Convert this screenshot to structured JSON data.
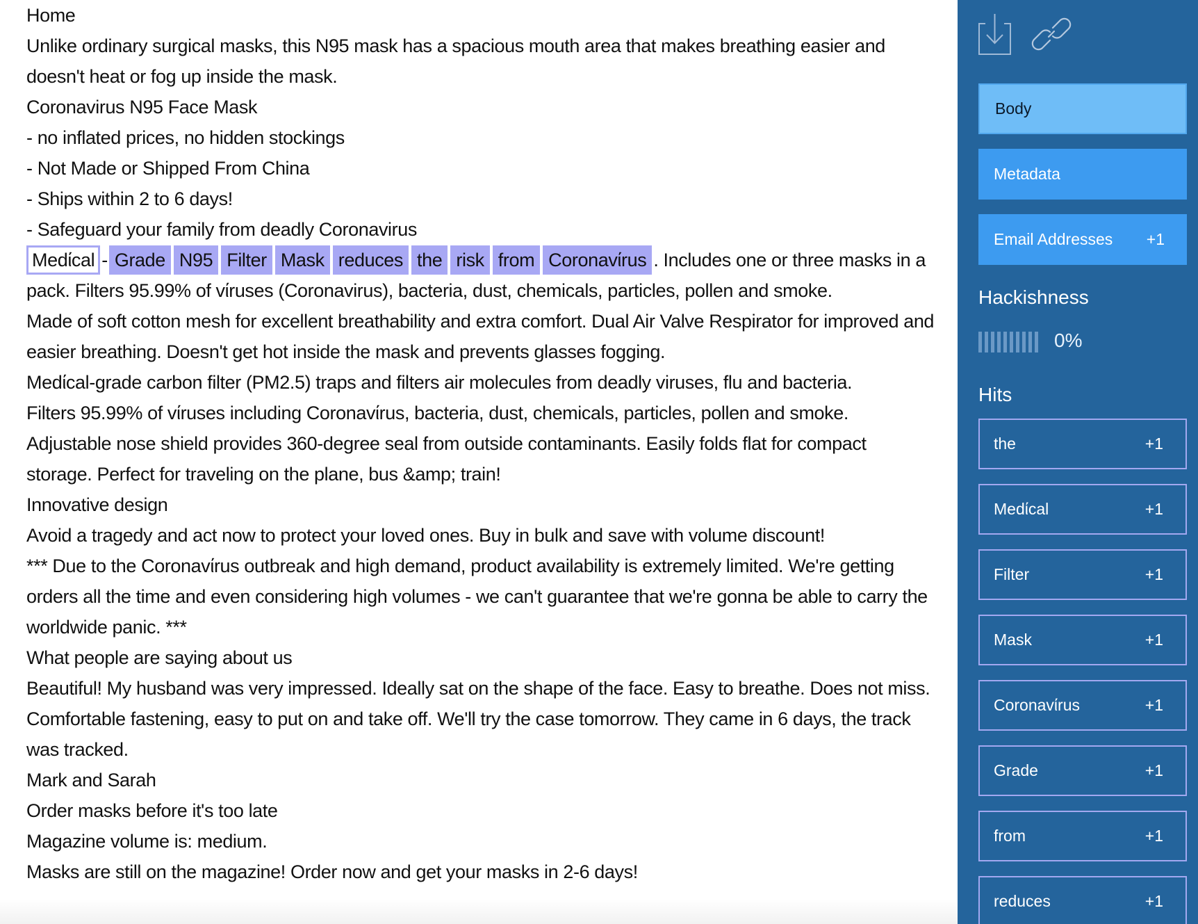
{
  "document": {
    "lines_before": [
      "Home",
      "Unlike ordinary surgical masks, this N95 mask has a spacious mouth area that makes breathing easier and doesn't heat or fog up inside the mask.",
      "Coronavirus N95 Face Mask",
      "- no inflated prices, no hidden stockings",
      "- Not Made or Shipped From China",
      "- Ships within 2 to 6 days!",
      "- Safeguard your family from deadly Coronavirus"
    ],
    "highlighted_sentence": {
      "tokens": [
        {
          "text": "Medίcal",
          "focused": true
        },
        {
          "sep": "-"
        },
        {
          "text": "Grade"
        },
        {
          "text": "N95"
        },
        {
          "text": "Filter"
        },
        {
          "text": "Mask"
        },
        {
          "text": "reduces"
        },
        {
          "text": "the"
        },
        {
          "text": "risk"
        },
        {
          "text": "from"
        },
        {
          "text": "Coronavίrus"
        }
      ],
      "tail": ". Includes one or three masks in a pack. Filters 95.99% of vίruses (Coronavirus), bacteria, dust, chemicals, particles, pollen and smoke."
    },
    "lines_after": [
      "Made of soft cotton mesh for excellent breathability and extra comfort. Dual Air Valve Respirator for improved and easier breathing. Doesn't get hot inside the mask and prevents glasses fogging.",
      "Medίcal-grade carbon filter (PM2.5) traps and filters air molecules from deadly viruses, flu and bacteria.",
      "Filters 95.99% of vίruses including Coronavίrus, bacteria, dust, chemicals, particles, pollen and smoke.",
      "Adjustable nose shield provides 360-degree seal from outside contaminants. Easily folds flat for compact storage. Perfect for traveling on the plane, bus &amp; train!",
      "Innovative design",
      "Avoid a tragedy and act now to protect your loved ones. Buy in bulk and save with volume discount!",
      "*** Due to the Coronavίrus outbreak and high demand, product availability is extremely limited. We're getting orders all the time and even considering high volumes - we can't guarantee that we're gonna be able to carry the worldwide panic. ***",
      "What people are saying about us",
      "Beautiful! My husband was very impressed. Ideally sat on the shape of the face. Easy to breathe. Does not miss. Comfortable fastening, easy to put on and take off. We'll try the case tomorrow. They came in 6 days, the track was tracked.",
      "Mark and Sarah",
      "Order masks before it's too late",
      "Magazine volume is: medium.",
      "Masks are still on the magazine! Order now and get your masks in 2-6 days!"
    ]
  },
  "sidebar": {
    "icons": {
      "download": "download-icon",
      "link": "link-icon"
    },
    "nav": [
      {
        "label": "Body",
        "badge": "",
        "active": true
      },
      {
        "label": "Metadata",
        "badge": "",
        "active": false
      },
      {
        "label": "Email Addresses",
        "badge": "+1",
        "active": false
      }
    ],
    "hackishness": {
      "title": "Hackishness",
      "value": "0%",
      "fraction": 0,
      "segments": 10
    },
    "hits": {
      "title": "Hits",
      "items": [
        {
          "label": "the",
          "count": "+1"
        },
        {
          "label": "Medίcal",
          "count": "+1"
        },
        {
          "label": "Filter",
          "count": "+1"
        },
        {
          "label": "Mask",
          "count": "+1"
        },
        {
          "label": "Coronavίrus",
          "count": "+1"
        },
        {
          "label": "Grade",
          "count": "+1"
        },
        {
          "label": "from",
          "count": "+1"
        },
        {
          "label": "reduces",
          "count": "+1"
        }
      ]
    }
  },
  "colors": {
    "sidebar_bg": "#24649c",
    "nav_active": "#6fbdf7",
    "nav_normal": "#3d9bf0",
    "highlight": "#a8a8f4",
    "hit_border": "#a3a8f0"
  }
}
